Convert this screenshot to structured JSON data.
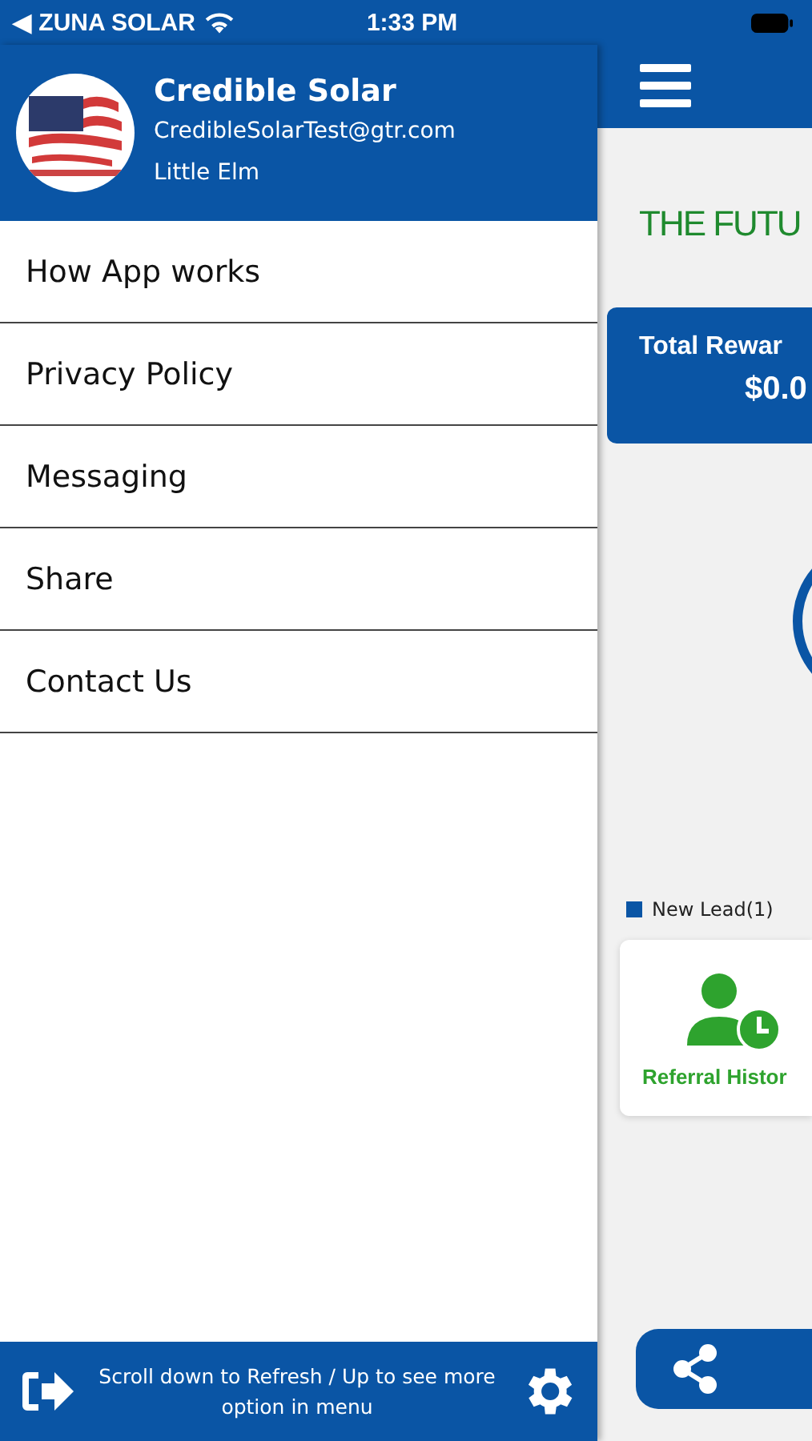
{
  "status_bar": {
    "back_label": "◀ ZUNA SOLAR",
    "time": "1:33 PM"
  },
  "drawer": {
    "profile": {
      "name": "Credible Solar",
      "email": "CredibleSolarTest@gtr.com",
      "location": "Little Elm"
    },
    "items": [
      {
        "label": "How App works"
      },
      {
        "label": "Privacy Policy"
      },
      {
        "label": "Messaging"
      },
      {
        "label": "Share"
      },
      {
        "label": "Contact Us"
      }
    ],
    "footer": {
      "hint": "Scroll down to Refresh / Up to see more option in menu"
    }
  },
  "main": {
    "banner": "THE FUTU",
    "rewards_card": {
      "title": "Total Rewar",
      "amount": "$0.0"
    },
    "legend": [
      {
        "label": "New Lead(1)",
        "color": "#0a55a5"
      }
    ],
    "tiles": [
      {
        "label": "Referral Histor"
      }
    ]
  }
}
